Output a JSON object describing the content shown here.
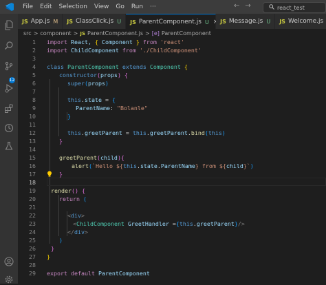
{
  "title_bar": {
    "menu": [
      "File",
      "Edit",
      "Selection",
      "View",
      "Go",
      "Run",
      "···"
    ],
    "nav_back": "←",
    "nav_forward": "→",
    "search_text": "react_test"
  },
  "activity_bar": {
    "source_control_badge": "12"
  },
  "tabs": [
    {
      "icon": "JS",
      "name": "App.js",
      "status": "M",
      "active": false
    },
    {
      "icon": "JS",
      "name": "ClassClick.js",
      "status": "U",
      "active": false
    },
    {
      "icon": "JS",
      "name": "ParentComponent.js",
      "status": "U",
      "active": true,
      "close": "×"
    },
    {
      "icon": "JS",
      "name": "Message.js",
      "status": "U",
      "active": false
    },
    {
      "icon": "JS",
      "name": "Welcome.js",
      "status": "U",
      "active": false
    }
  ],
  "breadcrumb": [
    "src",
    ">",
    "component",
    ">",
    "JS",
    "ParentComponent.js",
    ">",
    "[e]",
    "ParentComponent"
  ],
  "code_lines": [
    {
      "n": "1"
    },
    {
      "n": "2"
    },
    {
      "n": "3"
    },
    {
      "n": "4"
    },
    {
      "n": "5"
    },
    {
      "n": "6"
    },
    {
      "n": "7"
    },
    {
      "n": "8"
    },
    {
      "n": "9"
    },
    {
      "n": "10"
    },
    {
      "n": "11"
    },
    {
      "n": "12"
    },
    {
      "n": "13"
    },
    {
      "n": "14"
    },
    {
      "n": "15"
    },
    {
      "n": "16"
    },
    {
      "n": "17"
    },
    {
      "n": "18"
    },
    {
      "n": "19"
    },
    {
      "n": "20"
    },
    {
      "n": "21"
    },
    {
      "n": "22"
    },
    {
      "n": "23"
    },
    {
      "n": "24"
    },
    {
      "n": "25"
    },
    {
      "n": "26"
    },
    {
      "n": "27"
    },
    {
      "n": "28"
    },
    {
      "n": "29"
    }
  ],
  "code_text": {
    "l1": [
      "import",
      " React, ",
      "{",
      " Component ",
      "}",
      " from ",
      "'react'"
    ],
    "l2": [
      "import",
      " ChildComponent ",
      "from",
      " './ChildComponent'"
    ],
    "l4": [
      "class",
      " ParentComponent ",
      "extends",
      " Component ",
      "{"
    ],
    "l5": [
      "constructor",
      "(",
      "props",
      ")",
      " {"
    ],
    "l6": [
      "super",
      "(",
      "props",
      ")"
    ],
    "l8": [
      "this",
      ".",
      "state",
      " = ",
      "{"
    ],
    "l9": [
      "ParentName",
      ": ",
      "\"Bolanle\""
    ],
    "l10": [
      "}"
    ],
    "l12": [
      "this",
      ".",
      "greetParent",
      " = ",
      "this",
      ".",
      "greetParent",
      ".",
      "bind",
      "(",
      "this",
      ")"
    ],
    "l13": [
      "}"
    ],
    "l15": [
      "greetParent",
      "(",
      "child",
      "){"
    ],
    "l16": [
      "alert",
      "(",
      "`Hello ${",
      "this",
      ".",
      "state",
      ".",
      "ParentName",
      "}",
      " from ",
      "${",
      "child",
      "}`",
      ")"
    ],
    "l17": [
      "}"
    ],
    "l20": [
      "render",
      "() {"
    ],
    "l21": [
      "return",
      " ("
    ],
    "l23": [
      "<",
      "div",
      ">"
    ],
    "l24": [
      "<",
      "ChildComponent",
      " ",
      "GreetHandler",
      " =",
      "{",
      "this",
      ".",
      "greetParent",
      "}",
      "/>"
    ],
    "l25": [
      "</",
      "div",
      ">"
    ],
    "l26": [
      ")"
    ],
    "l27": [
      "}"
    ],
    "l28": [
      "}"
    ],
    "l30": [
      "export",
      " ",
      "default",
      " ParentComponent"
    ]
  },
  "colors": {
    "editor_bg": "#1e1e1e",
    "activity_bar": "#333333",
    "accent": "#0078d4",
    "keyword": "#c586c0",
    "string": "#ce9178",
    "class": "#4ec9b0"
  }
}
